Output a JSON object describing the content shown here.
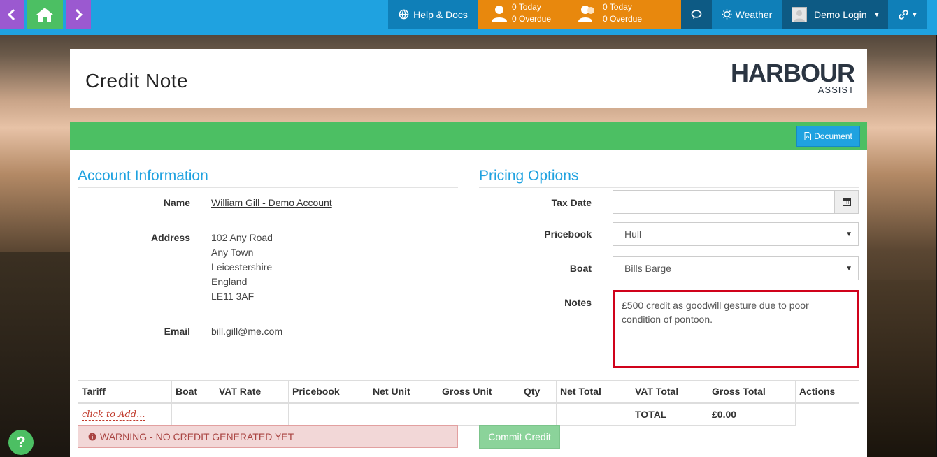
{
  "nav": {
    "help_label": "Help & Docs",
    "tasks": [
      {
        "today": "0 Today",
        "overdue": "0 Overdue"
      },
      {
        "today": "0 Today",
        "overdue": "0 Overdue"
      }
    ],
    "weather_label": "Weather",
    "user_label": "Demo Login"
  },
  "header": {
    "title": "Credit Note",
    "logo_main": "HARBOUR",
    "logo_sub": "ASSIST"
  },
  "toolbar": {
    "document_label": "Document"
  },
  "account": {
    "section_title": "Account Information",
    "name_label": "Name",
    "name_value": "William Gill - Demo Account",
    "address_label": "Address",
    "address_lines": [
      "102 Any Road",
      "Any Town",
      "Leicestershire",
      "England",
      "LE11 3AF"
    ],
    "email_label": "Email",
    "email_value": "bill.gill@me.com"
  },
  "pricing": {
    "section_title": "Pricing Options",
    "tax_date_label": "Tax Date",
    "tax_date_value": "",
    "pricebook_label": "Pricebook",
    "pricebook_value": "Hull",
    "boat_label": "Boat",
    "boat_value": "Bills Barge",
    "notes_label": "Notes",
    "notes_value": "£500 credit as goodwill gesture due to poor condition of pontoon."
  },
  "table": {
    "columns": [
      "Tariff",
      "Boat",
      "VAT Rate",
      "Pricebook",
      "Net Unit",
      "Gross Unit",
      "Qty",
      "Net Total",
      "VAT Total",
      "Gross Total",
      "Actions"
    ],
    "add_label": "click to Add...",
    "total_label": "TOTAL",
    "total_value": "£0.00"
  },
  "footer": {
    "warning_text": "WARNING - NO CREDIT GENERATED YET",
    "commit_label": "Commit Credit"
  },
  "help_bubble": "?",
  "colors": {
    "topbar": "#1fa2e0",
    "nav_purple": "#9b59d0",
    "nav_green": "#4cbf63",
    "tasks_orange": "#e8880d",
    "highlight_red": "#d0021b"
  }
}
